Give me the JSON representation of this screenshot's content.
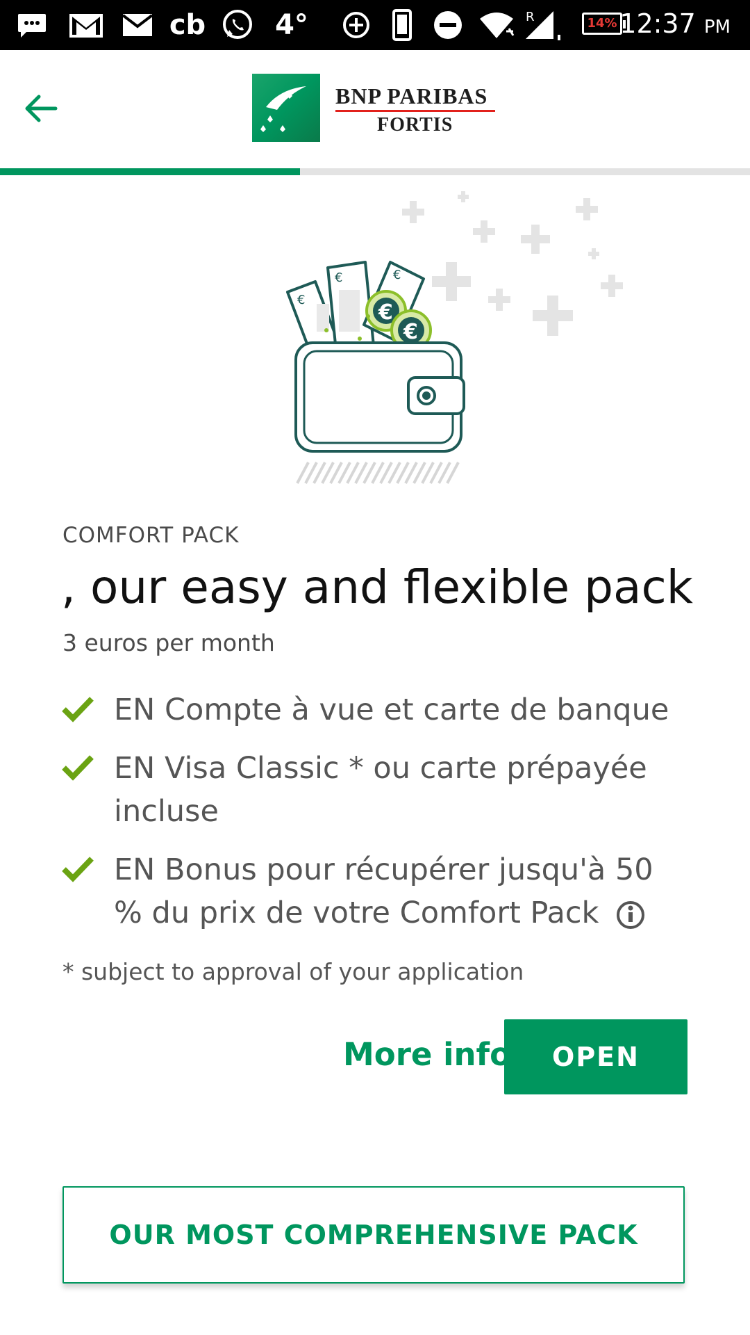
{
  "status_bar": {
    "temperature": "4°",
    "app_label": "cb",
    "battery": "14%",
    "time": "12:37",
    "ampm": "PM",
    "icons": [
      "message-icon",
      "gmail-icon",
      "mail-icon",
      "cb-icon",
      "whatsapp-icon",
      "data-saver-icon",
      "phone-icon",
      "dnd-icon",
      "wifi-icon",
      "signal-icon"
    ]
  },
  "header": {
    "brand_name": "BNP PARIBAS",
    "brand_sub": "FORTIS",
    "back_icon": "arrow-left-icon"
  },
  "progress": {
    "value": 0.4
  },
  "colors": {
    "accent": "#00965e",
    "check": "#6aa312",
    "battery_low": "#e53935",
    "logo_red": "#e2211c"
  },
  "pack": {
    "eyebrow": "COMFORT PACK",
    "title": ", our easy and flexible pack",
    "price": "3 euros per month",
    "features": [
      "EN Compte à vue et carte de banque",
      "EN Visa Classic * ou carte prépayée incluse",
      "EN Bonus pour récupérer jusqu'à 50 % du prix de votre Comfort Pack"
    ],
    "footnote": "* subject to approval of your application"
  },
  "actions": {
    "more_info": "More info",
    "open": "OPEN",
    "comprehensive": "OUR MOST COMPREHENSIVE PACK"
  }
}
